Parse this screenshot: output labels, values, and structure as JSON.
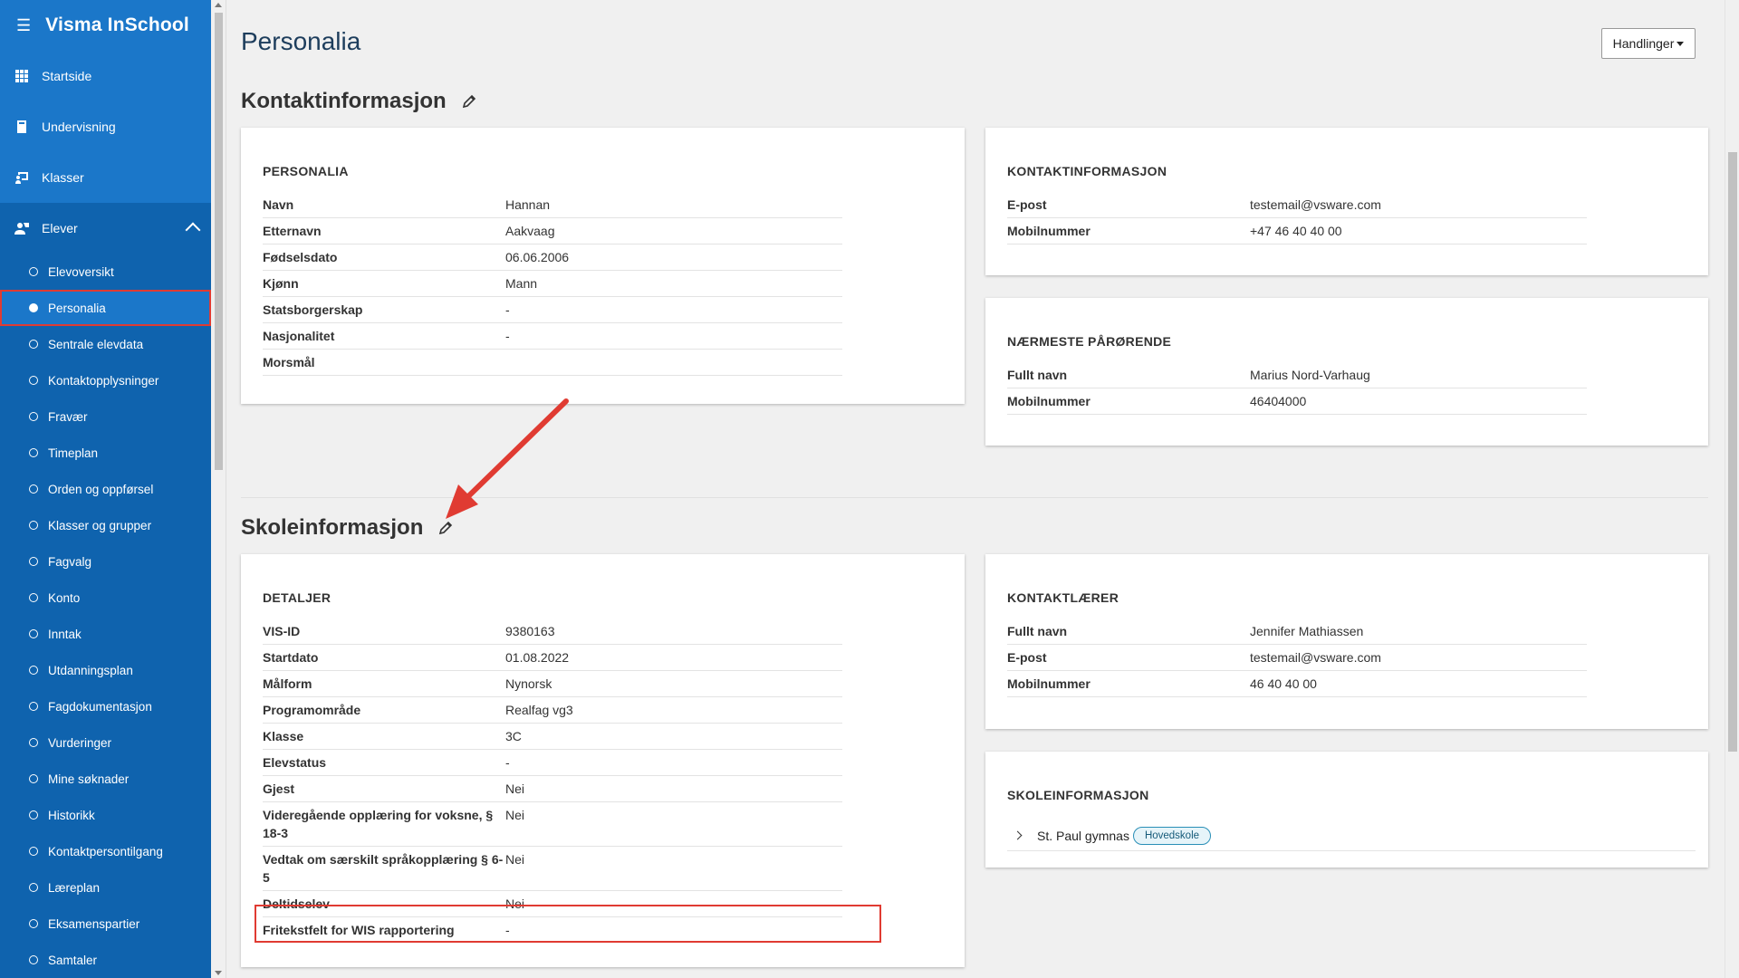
{
  "app": {
    "title": "Visma InSchool"
  },
  "sidebar": {
    "top_items": [
      {
        "label": "Startside",
        "icon": "grid-icon"
      },
      {
        "label": "Undervisning",
        "icon": "book-icon"
      },
      {
        "label": "Klasser",
        "icon": "classroom-icon"
      }
    ],
    "group": {
      "label": "Elever",
      "icon": "students-icon"
    },
    "sub_items": [
      {
        "label": "Elevoversikt"
      },
      {
        "label": "Personalia",
        "active": true
      },
      {
        "label": "Sentrale elevdata"
      },
      {
        "label": "Kontaktopplysninger"
      },
      {
        "label": "Fravær"
      },
      {
        "label": "Timeplan"
      },
      {
        "label": "Orden og oppførsel"
      },
      {
        "label": "Klasser og grupper"
      },
      {
        "label": "Fagvalg"
      },
      {
        "label": "Konto"
      },
      {
        "label": "Inntak"
      },
      {
        "label": "Utdanningsplan"
      },
      {
        "label": "Fagdokumentasjon"
      },
      {
        "label": "Vurderinger"
      },
      {
        "label": "Mine søknader"
      },
      {
        "label": "Historikk"
      },
      {
        "label": "Kontaktpersontilgang"
      },
      {
        "label": "Læreplan"
      },
      {
        "label": "Eksamenspartier"
      },
      {
        "label": "Samtaler"
      }
    ]
  },
  "header": {
    "title": "Personalia",
    "actions_label": "Handlinger"
  },
  "contact_section": {
    "title": "Kontaktinformasjon",
    "personalia": {
      "heading": "PERSONALIA",
      "rows": [
        {
          "label": "Navn",
          "value": "Hannan"
        },
        {
          "label": "Etternavn",
          "value": "Aakvaag"
        },
        {
          "label": "Fødselsdato",
          "value": "06.06.2006"
        },
        {
          "label": "Kjønn",
          "value": "Mann"
        },
        {
          "label": "Statsborgerskap",
          "value": "-"
        },
        {
          "label": "Nasjonalitet",
          "value": "-"
        },
        {
          "label": "Morsmål",
          "value": ""
        }
      ]
    },
    "contact": {
      "heading": "KONTAKTINFORMASJON",
      "rows": [
        {
          "label": "E-post",
          "value": "testemail@vsware.com"
        },
        {
          "label": "Mobilnummer",
          "value": "+47 46 40 40 00"
        }
      ]
    },
    "relative": {
      "heading": "NÆRMESTE PÅRØRENDE",
      "rows": [
        {
          "label": "Fullt navn",
          "value": "Marius Nord-Varhaug"
        },
        {
          "label": "Mobilnummer",
          "value": "46404000"
        }
      ]
    }
  },
  "school_section": {
    "title": "Skoleinformasjon",
    "details": {
      "heading": "DETALJER",
      "rows": [
        {
          "label": "VIS-ID",
          "value": "9380163"
        },
        {
          "label": "Startdato",
          "value": "01.08.2022"
        },
        {
          "label": "Målform",
          "value": "Nynorsk"
        },
        {
          "label": "Programområde",
          "value": "Realfag vg3"
        },
        {
          "label": "Klasse",
          "value": "3C"
        },
        {
          "label": "Elevstatus",
          "value": "-"
        },
        {
          "label": "Gjest",
          "value": "Nei"
        },
        {
          "label": "Videregående opplæring for voksne, § 18-3",
          "value": "Nei"
        },
        {
          "label": "Vedtak om særskilt språkopplæring § 6-5",
          "value": "Nei"
        },
        {
          "label": "Deltidselev",
          "value": "Nei"
        },
        {
          "label": "Fritekstfelt for WIS rapportering",
          "value": "-"
        }
      ]
    },
    "teacher": {
      "heading": "KONTAKTLÆRER",
      "rows": [
        {
          "label": "Fullt navn",
          "value": "Jennifer Mathiassen"
        },
        {
          "label": "E-post",
          "value": "testemail@vsware.com"
        },
        {
          "label": "Mobilnummer",
          "value": "46 40 40 00"
        }
      ]
    },
    "school_info": {
      "heading": "SKOLEINFORMASJON",
      "school_name": "St. Paul gymnas",
      "badge": "Hovedskole"
    }
  },
  "colors": {
    "sidebar": "#1b77c9",
    "sidebar_group": "#0f63ae",
    "highlight": "#e03b32",
    "badge_border": "#2a8fb7"
  }
}
